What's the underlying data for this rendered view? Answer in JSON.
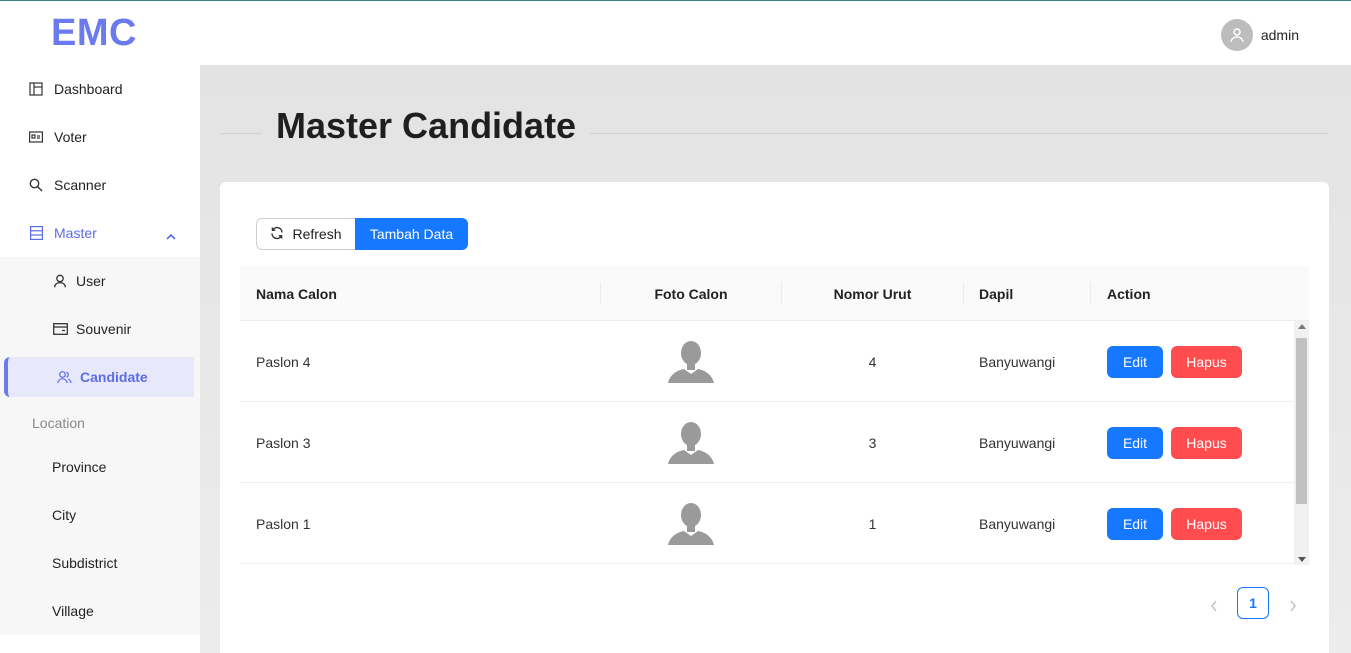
{
  "app": {
    "logo": "EMC",
    "user_name": "admin"
  },
  "sidebar": {
    "items": [
      {
        "label": "Dashboard"
      },
      {
        "label": "Voter"
      },
      {
        "label": "Scanner"
      },
      {
        "label": "Master"
      }
    ],
    "master_items": [
      {
        "label": "User"
      },
      {
        "label": "Souvenir"
      },
      {
        "label": "Candidate"
      }
    ],
    "location_group": "Location",
    "location_items": [
      {
        "label": "Province"
      },
      {
        "label": "City"
      },
      {
        "label": "Subdistrict"
      },
      {
        "label": "Village"
      }
    ]
  },
  "page": {
    "title": "Master Candidate"
  },
  "toolbar": {
    "refresh_label": "Refresh",
    "add_label": "Tambah Data"
  },
  "table": {
    "columns": [
      "Nama Calon",
      "Foto Calon",
      "Nomor Urut",
      "Dapil",
      "Action"
    ],
    "rows": [
      {
        "nama": "Paslon 4",
        "nomor": "4",
        "dapil": "Banyuwangi",
        "edit": "Edit",
        "hapus": "Hapus"
      },
      {
        "nama": "Paslon 3",
        "nomor": "3",
        "dapil": "Banyuwangi",
        "edit": "Edit",
        "hapus": "Hapus"
      },
      {
        "nama": "Paslon 1",
        "nomor": "1",
        "dapil": "Banyuwangi",
        "edit": "Edit",
        "hapus": "Hapus"
      }
    ]
  },
  "pagination": {
    "current": "1"
  },
  "colors": {
    "primary": "#1677ff",
    "danger": "#ff4d4f",
    "accent": "#6c7af0"
  },
  "icons": {
    "dashboard": "layout-icon",
    "voter": "id-card-icon",
    "scanner": "search-icon",
    "master": "database-icon",
    "user": "user-icon",
    "souvenir": "wallet-icon",
    "candidate": "team-icon",
    "refresh": "refresh-icon",
    "avatar": "user-avatar-icon"
  }
}
